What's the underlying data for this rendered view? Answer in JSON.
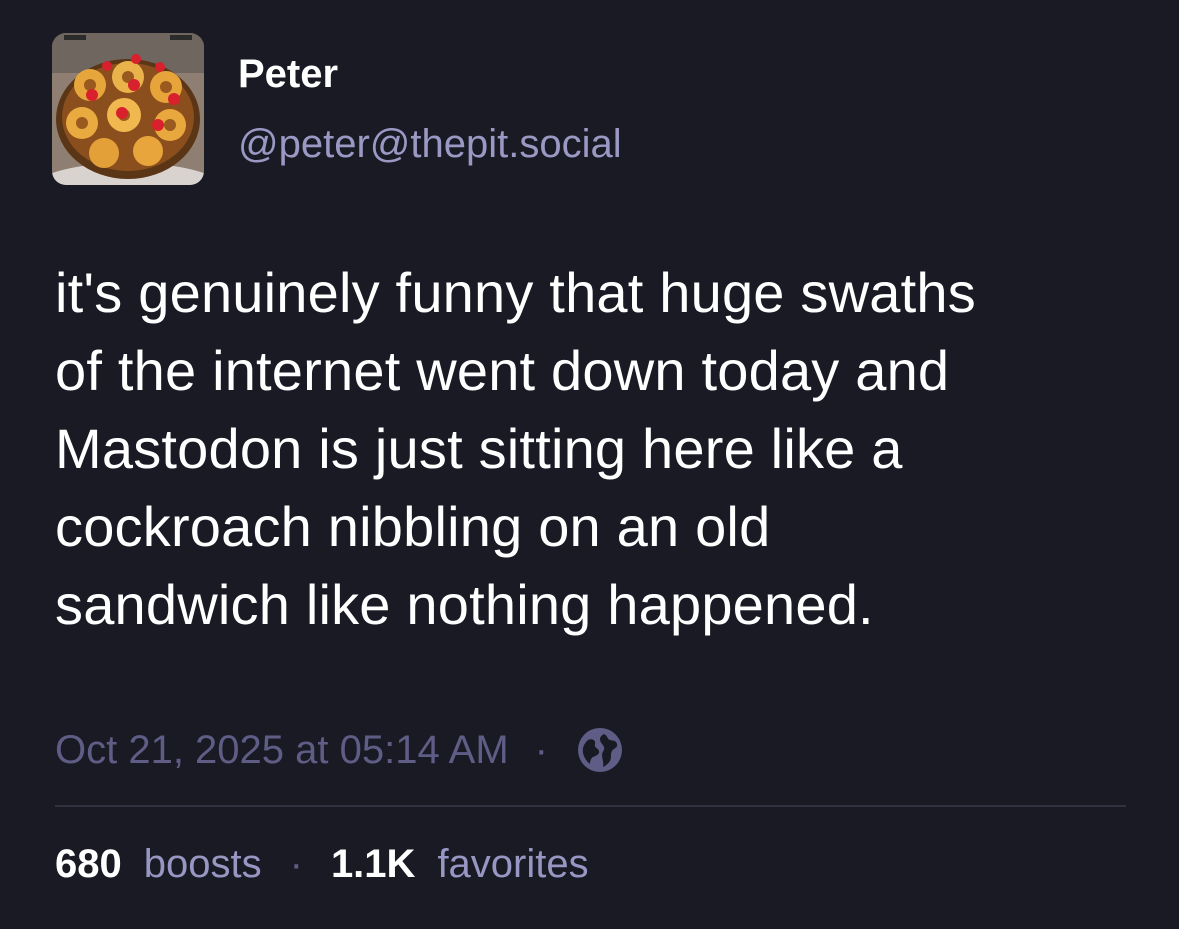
{
  "author": {
    "display_name": "Peter",
    "handle": "@peter@thepit.social",
    "avatar_icon": "pineapple-upside-down-cake-avatar"
  },
  "post": {
    "lines": [
      "it's genuinely funny that huge swaths",
      "of the internet went down today and",
      "Mastodon is just sitting here like a",
      "cockroach nibbling on an old",
      "sandwich like nothing happened."
    ],
    "timestamp": "Oct 21, 2025 at 05:14 AM",
    "separator": "·",
    "visibility_icon": "globe-icon"
  },
  "stats": {
    "boosts_count": "680",
    "boosts_label": "boosts",
    "favorites_count": "1.1K",
    "favorites_label": "favorites",
    "separator": "·"
  },
  "colors": {
    "background": "#191a24",
    "text": "#ffffff",
    "handle": "#9b98c4",
    "muted": "#5f5d85",
    "divider": "#31303f"
  }
}
